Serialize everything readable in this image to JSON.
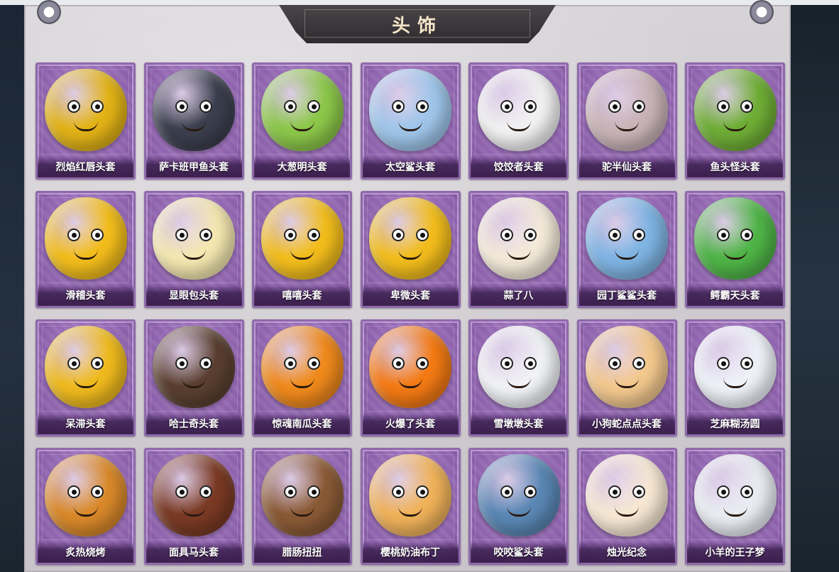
{
  "page": {
    "title": "头饰"
  },
  "items": [
    {
      "label": "烈焰红唇头套",
      "icon": "yellow-pikachu-mask-icon",
      "color": "#e2b317"
    },
    {
      "label": "萨卡班甲鱼头套",
      "icon": "dark-fish-head-icon",
      "color": "#3b3f4e"
    },
    {
      "label": "大葱明头套",
      "icon": "green-onion-head-icon",
      "color": "#8cc74a"
    },
    {
      "label": "太空鲨头套",
      "icon": "blue-shark-head-icon",
      "color": "#9fc6ea"
    },
    {
      "label": "饺饺者头套",
      "icon": "white-dumpling-head-icon",
      "color": "#f1f1f1"
    },
    {
      "label": "驼半仙头套",
      "icon": "alpaca-sunglasses-head-icon",
      "color": "#c9b3b7"
    },
    {
      "label": "鱼头怪头套",
      "icon": "green-fish-monster-head-icon",
      "color": "#6fae36"
    },
    {
      "label": "滑稽头套",
      "icon": "smirk-emoji-head-icon",
      "color": "#f2bd1c"
    },
    {
      "label": "显眼包头套",
      "icon": "lightbulb-king-head-icon",
      "color": "#f4e7b0"
    },
    {
      "label": "嘻嘻头套",
      "icon": "grin-emoji-head-icon",
      "color": "#f2bd1c"
    },
    {
      "label": "卑微头套",
      "icon": "shy-emoji-head-icon",
      "color": "#f2bd1c"
    },
    {
      "label": "蒜了八",
      "icon": "garlic-head-icon",
      "color": "#f3ead9"
    },
    {
      "label": "园丁鲨鲨头套",
      "icon": "gardener-shark-head-icon",
      "color": "#7fb4e3"
    },
    {
      "label": "鳄霸天头套",
      "icon": "crocodile-head-icon",
      "color": "#4fb447"
    },
    {
      "label": "呆滞头套",
      "icon": "stare-emoji-head-icon",
      "color": "#efba1e"
    },
    {
      "label": "哈士奇头套",
      "icon": "husky-sunglasses-head-icon",
      "color": "#5a3f30"
    },
    {
      "label": "惊魂南瓜头套",
      "icon": "pumpkin-head-icon",
      "color": "#f08a1c"
    },
    {
      "label": "火爆了头套",
      "icon": "fire-head-icon",
      "color": "#f47a14"
    },
    {
      "label": "雪墩墩头套",
      "icon": "snowman-reindeer-head-icon",
      "color": "#f0f2f5"
    },
    {
      "label": "小狗蛇点点头套",
      "icon": "snake-dog-head-icon",
      "color": "#f3c88e"
    },
    {
      "label": "芝麻糊汤圆",
      "icon": "rice-ball-flower-head-icon",
      "color": "#eef2f8"
    },
    {
      "label": "炙热烧烤",
      "icon": "bbq-meat-head-icon",
      "color": "#d9892a"
    },
    {
      "label": "面具马头套",
      "icon": "horse-mask-head-icon",
      "color": "#7a3a24"
    },
    {
      "label": "腊肠扭扭",
      "icon": "sausage-dog-head-icon",
      "color": "#8a5a36"
    },
    {
      "label": "樱桃奶油布丁",
      "icon": "cherry-pudding-head-icon",
      "color": "#f0b25a"
    },
    {
      "label": "咬咬鲨头套",
      "icon": "biting-shark-head-icon",
      "color": "#5a87b4"
    },
    {
      "label": "烛光纪念",
      "icon": "candle-head-icon",
      "color": "#f6e7d3"
    },
    {
      "label": "小羊的王子梦",
      "icon": "sheep-crown-head-icon",
      "color": "#e9edf2"
    }
  ]
}
